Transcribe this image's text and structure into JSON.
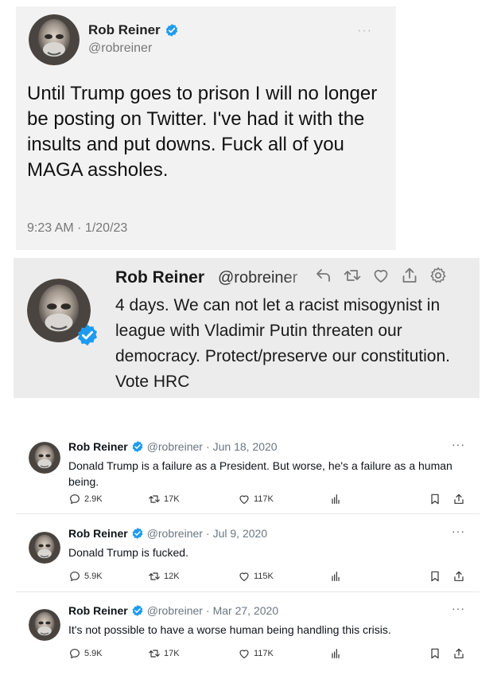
{
  "tweet_top": {
    "name": "Rob Reiner",
    "handle": "@robreiner",
    "text": "Until Trump goes to prison I will no longer be posting on Twitter. I've had it with the insults and put downs. Fuck all of you MAGA assholes.",
    "timestamp": "9:23 AM · 1/20/23",
    "more": "···"
  },
  "tweet_old": {
    "name": "Rob Reiner",
    "handle": "@robreiner",
    "text": "4 days. We can not let a racist misogynist in league with Vladimir Putin threaten our democracy. Protect/preserve our constitution. Vote HRC",
    "icons": [
      "reply-icon",
      "retweet-icon",
      "like-icon",
      "share-icon",
      "gear-icon"
    ]
  },
  "tweets": [
    {
      "name": "Rob Reiner",
      "handle": "@robreiner",
      "date": "Jun 18, 2020",
      "text": "Donald Trump is a failure as a President. But worse, he's a failure as a human being.",
      "replies": "2.9K",
      "retweets": "17K",
      "likes": "117K"
    },
    {
      "name": "Rob Reiner",
      "handle": "@robreiner",
      "date": "Jul 9, 2020",
      "text": "Donald Trump is fucked.",
      "replies": "5.9K",
      "retweets": "12K",
      "likes": "115K"
    },
    {
      "name": "Rob Reiner",
      "handle": "@robreiner",
      "date": "Mar 27, 2020",
      "text": "It's not possible to have a worse human being handling this crisis.",
      "replies": "5.9K",
      "retweets": "17K",
      "likes": "117K"
    }
  ],
  "colors": {
    "verified": "#1d9bf0",
    "panel_gray": "#f2f2f2",
    "muted": "#6b7680"
  }
}
